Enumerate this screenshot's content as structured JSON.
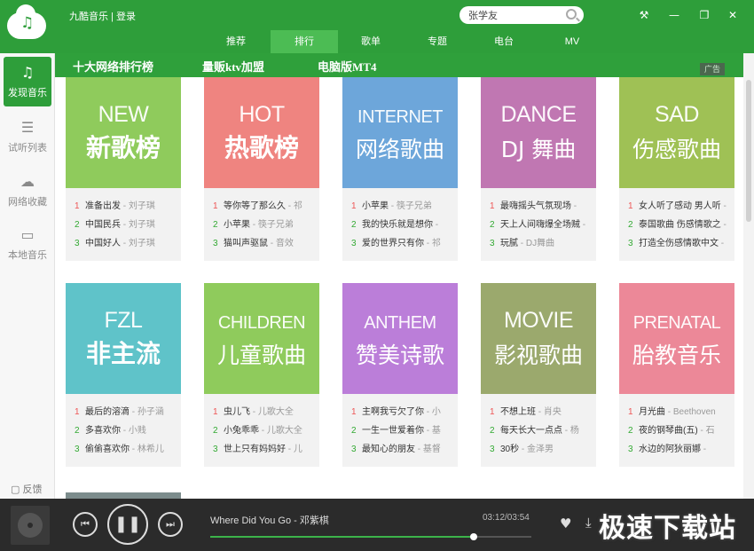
{
  "app": {
    "title": "九酷音乐 | 登录",
    "logo_icon": "music-note-icon"
  },
  "search": {
    "value": "张学友",
    "placeholder": ""
  },
  "window_controls": {
    "settings": "⚒",
    "minimize": "—",
    "restore": "❐",
    "close": "✕"
  },
  "nav": {
    "tabs": [
      {
        "label": "推荐"
      },
      {
        "label": "排行"
      },
      {
        "label": "歌单"
      },
      {
        "label": "专题"
      },
      {
        "label": "电台"
      },
      {
        "label": "MV"
      }
    ],
    "active_index": 1
  },
  "sidebar": {
    "items": [
      {
        "label": "发现音乐",
        "icon": "music-note-icon",
        "glyph": "♫"
      },
      {
        "label": "试听列表",
        "icon": "list-icon",
        "glyph": "☰"
      },
      {
        "label": "网络收藏",
        "icon": "cloud-icon",
        "glyph": "☁"
      },
      {
        "label": "本地音乐",
        "icon": "monitor-icon",
        "glyph": "▭"
      }
    ],
    "feedback": "反馈"
  },
  "ad": {
    "items": [
      "十大网络排行榜",
      "量贩ktv加盟",
      "电脑版MT4"
    ],
    "tag": "广告"
  },
  "charts": [
    {
      "en": "NEW",
      "cn": "新歌榜",
      "color": "#8fcb5c",
      "songs": [
        {
          "num": "1",
          "title": "准备出发",
          "artist": "刘子琪"
        },
        {
          "num": "2",
          "title": "中国民兵",
          "artist": "刘子琪"
        },
        {
          "num": "3",
          "title": "中国好人",
          "artist": "刘子琪"
        }
      ]
    },
    {
      "en": "HOT",
      "cn": "热歌榜",
      "color": "#ef8480",
      "songs": [
        {
          "num": "1",
          "title": "等你等了那么久",
          "artist": "祁"
        },
        {
          "num": "2",
          "title": "小苹果",
          "artist": "筷子兄弟"
        },
        {
          "num": "3",
          "title": "猫叫声驱鼠",
          "artist": "音效"
        }
      ]
    },
    {
      "en": "INTERNET",
      "cn": "网络歌曲",
      "color": "#6da6da",
      "songs": [
        {
          "num": "1",
          "title": "小苹果",
          "artist": "筷子兄弟"
        },
        {
          "num": "2",
          "title": "我的快乐就是想你",
          "artist": ""
        },
        {
          "num": "3",
          "title": "爱的世界只有你",
          "artist": "祁"
        }
      ]
    },
    {
      "en": "DANCE",
      "cn": "DJ 舞曲",
      "color": "#c077b2",
      "songs": [
        {
          "num": "1",
          "title": "最嗨摇头气氛现场",
          "artist": ""
        },
        {
          "num": "2",
          "title": "天上人间嗨爆全场贼",
          "artist": ""
        },
        {
          "num": "3",
          "title": "玩腻",
          "artist": "DJ舞曲"
        }
      ]
    },
    {
      "en": "SAD",
      "cn": "伤感歌曲",
      "color": "#9fc155",
      "songs": [
        {
          "num": "1",
          "title": "女人听了感动 男人听",
          "artist": ""
        },
        {
          "num": "2",
          "title": "泰国歌曲 伤感情歌之",
          "artist": ""
        },
        {
          "num": "3",
          "title": "打造全伤感情歌中文",
          "artist": ""
        }
      ]
    },
    {
      "en": "FZL",
      "cn": "非主流",
      "color": "#5fc3c9",
      "songs": [
        {
          "num": "1",
          "title": "最后的溶滴",
          "artist": "孙子涵"
        },
        {
          "num": "2",
          "title": "多喜欢你",
          "artist": "小贱"
        },
        {
          "num": "3",
          "title": "偷偷喜欢你",
          "artist": "林希儿"
        }
      ]
    },
    {
      "en": "CHILDREN",
      "cn": "儿童歌曲",
      "color": "#8fcb5c",
      "songs": [
        {
          "num": "1",
          "title": "虫儿飞",
          "artist": "儿歌大全"
        },
        {
          "num": "2",
          "title": "小兔乖乖",
          "artist": "儿歌大全"
        },
        {
          "num": "3",
          "title": "世上只有妈妈好",
          "artist": "儿"
        }
      ]
    },
    {
      "en": "ANTHEM",
      "cn": "赞美诗歌",
      "color": "#bb7ed9",
      "songs": [
        {
          "num": "1",
          "title": "主啊我亏欠了你",
          "artist": "小"
        },
        {
          "num": "2",
          "title": "一生一世爱着你",
          "artist": "基"
        },
        {
          "num": "3",
          "title": "最知心的朋友",
          "artist": "基督"
        }
      ]
    },
    {
      "en": "MOVIE",
      "cn": "影视歌曲",
      "color": "#9ba96d",
      "songs": [
        {
          "num": "1",
          "title": "不想上班",
          "artist": "肖央"
        },
        {
          "num": "2",
          "title": "每天长大一点点",
          "artist": "杨"
        },
        {
          "num": "3",
          "title": "30秒",
          "artist": "金泽男"
        }
      ]
    },
    {
      "en": "PRENATAL",
      "cn": "胎教音乐",
      "color": "#ec8898",
      "songs": [
        {
          "num": "1",
          "title": "月光曲",
          "artist": "Beethoven"
        },
        {
          "num": "2",
          "title": "夜的钢琴曲(五)",
          "artist": "石"
        },
        {
          "num": "3",
          "title": "水边的阿狄丽娜",
          "artist": ""
        }
      ]
    }
  ],
  "player": {
    "track": "Where Did You Go - 邓紫棋",
    "time": "03:12/03:54",
    "progress": 0.82,
    "prev_glyph": "⏮",
    "play_glyph": "❚❚",
    "next_glyph": "⏭",
    "heart_glyph": "♥",
    "download_glyph": "⤓"
  },
  "watermark": "极速下载站"
}
